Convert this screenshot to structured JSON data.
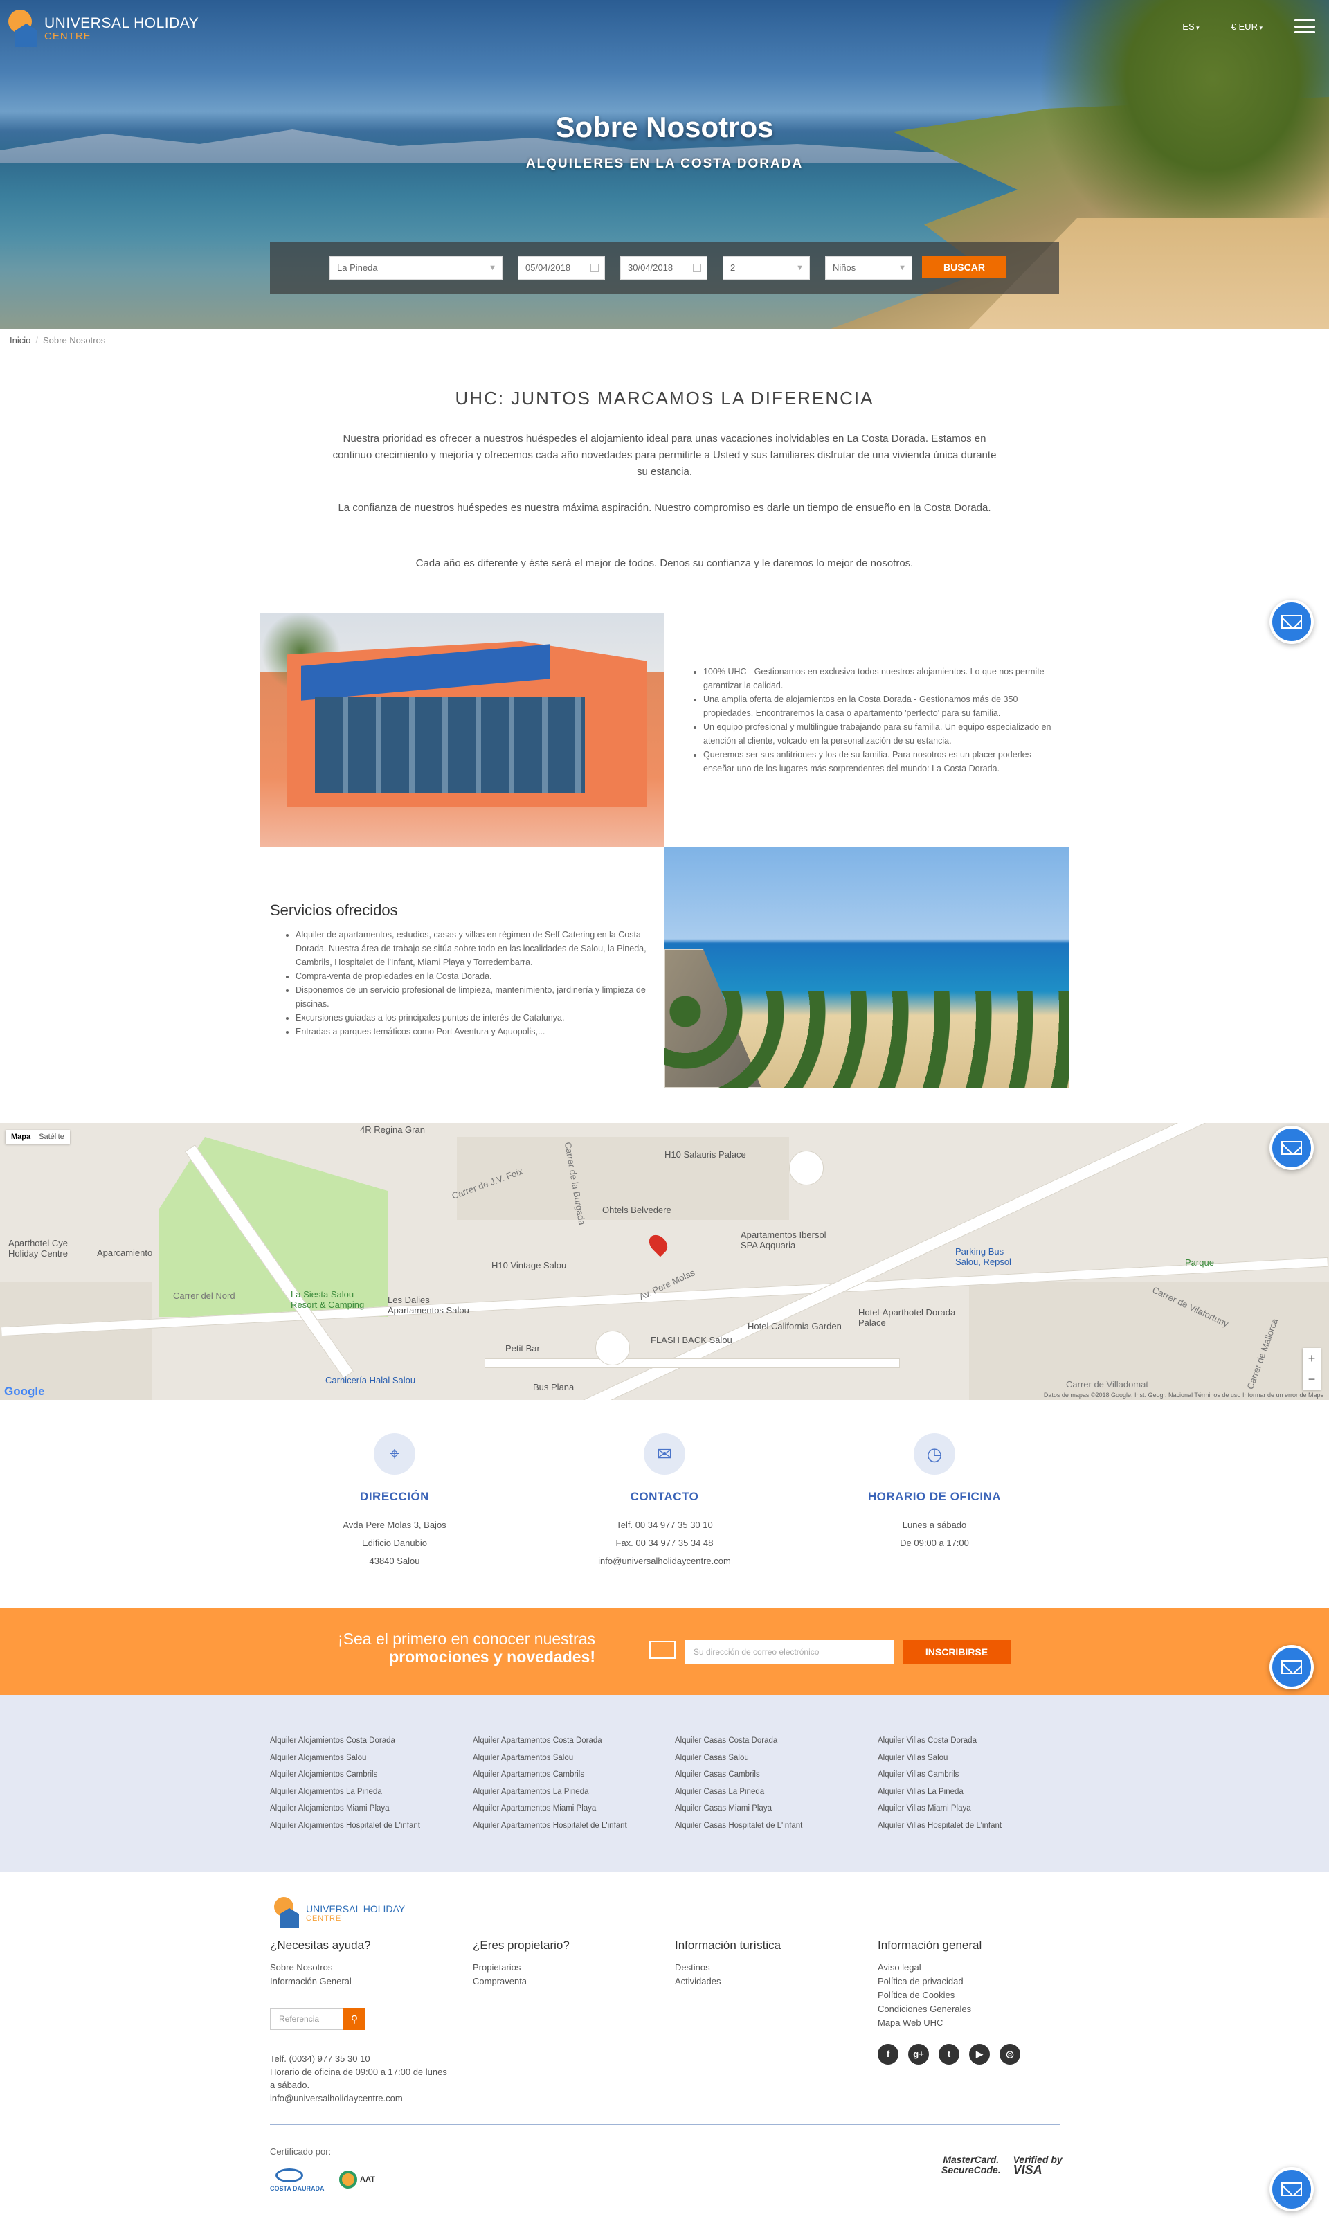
{
  "brand": {
    "name": "UNIVERSAL HOLIDAY",
    "sub": "CENTRE"
  },
  "nav": {
    "lang": "ES",
    "currency": "€ EUR"
  },
  "hero": {
    "title": "Sobre Nosotros",
    "subtitle": "ALQUILERES EN LA COSTA DORADA"
  },
  "search": {
    "location": "La Pineda",
    "checkin": "05/04/2018",
    "checkout": "30/04/2018",
    "adults": "2",
    "children": "Niños",
    "button": "BUSCAR"
  },
  "breadcrumb": {
    "home": "Inicio",
    "current": "Sobre Nosotros"
  },
  "intro": {
    "title": "UHC: JUNTOS MARCAMOS LA DIFERENCIA",
    "p1": "Nuestra prioridad es ofrecer a nuestros huéspedes el alojamiento ideal para unas vacaciones inolvidables en La Costa Dorada. Estamos en continuo crecimiento y mejoría y ofrecemos cada año novedades para permitirle a Usted y sus familiares disfrutar de una vivienda única durante su estancia.",
    "p2": "La confianza de nuestros huéspedes es nuestra máxima aspiración. Nuestro compromiso es darle un tiempo de ensueño en la Costa Dorada.",
    "p3": "Cada año es diferente y éste será el mejor de todos. Denos su confianza y le daremos lo mejor de nosotros."
  },
  "features": [
    "100% UHC - Gestionamos en exclusiva todos nuestros alojamientos. Lo que nos permite garantizar la calidad.",
    "Una amplia oferta de alojamientos en la Costa Dorada - Gestionamos más de 350 propiedades. Encontraremos la casa o apartamento 'perfecto' para su familia.",
    "Un equipo profesional y multilingüe trabajando para su familia. Un equipo especializado en atención al cliente, volcado en la personalización de su estancia.",
    "Queremos ser sus anfitriones y los de su familia. Para nosotros es un placer poderles enseñar uno de los lugares más sorprendentes del mundo: La Costa Dorada."
  ],
  "services": {
    "title": "Servicios ofrecidos",
    "items": [
      "Alquiler de apartamentos, estudios, casas y villas en régimen de Self Catering en la Costa Dorada. Nuestra área de trabajo se sitúa sobre todo en las localidades de Salou, la Pineda, Cambrils, Hospitalet de l'Infant, Miami Playa y Torredembarra.",
      "Compra-venta de propiedades en la Costa Dorada.",
      "Disponemos de un servicio profesional de limpieza, mantenimiento, jardinería y limpieza de piscinas.",
      "Excursiones guiadas a los principales puntos de interés de Catalunya.",
      "Entradas a parques temáticos como Port Aventura y Aquopolis,..."
    ]
  },
  "map": {
    "tab_map": "Mapa",
    "tab_sat": "Satélite",
    "labels": [
      "4R Regina Gran",
      "H10 Salauris Palace",
      "Ohtels Belvedere",
      "H10 Vintage Salou",
      "Apartamentos Ibersol SPA Aqquaria",
      "Aparthotel Cye Holiday Centre",
      "Aparcamiento",
      "Carrer del Nord",
      "La Siesta Salou Resort & Camping",
      "Les Dalies Apartamentos Salou",
      "Hotel California Garden",
      "FLASH BACK Salou",
      "Hotel-Aparthotel Dorada Palace",
      "Parking Bus Salou, Repsol",
      "Parque",
      "Petit Bar",
      "Carnicería Halal Salou",
      "Bus Plana",
      "Av. Pere Molas",
      "Carrer de J.V. Foix",
      "Carrer de la Burgada",
      "Carrer de Vilafortuny",
      "Carrer de Mallorca",
      "Carrer de Villadomat"
    ],
    "attribution": "Datos de mapas ©2018 Google, Inst. Geogr. Nacional   Términos de uso   Informar de un error de Maps",
    "google": "Google"
  },
  "contact": [
    {
      "icon": "location-icon",
      "title": "DIRECCIÓN",
      "lines": [
        "Avda Pere Molas 3, Bajos",
        "Edificio Danubio",
        "43840 Salou"
      ]
    },
    {
      "icon": "mail-icon",
      "title": "CONTACTO",
      "lines": [
        "Telf. 00 34 977 35 30 10",
        "Fax. 00 34 977 35 34 48",
        "info@universalholidaycentre.com"
      ]
    },
    {
      "icon": "clock-icon",
      "title": "HORARIO DE OFICINA",
      "lines": [
        "Lunes a sábado",
        "De 09:00 a 17:00"
      ]
    }
  ],
  "newsletter": {
    "line1": "¡Sea el primero en conocer nuestras",
    "line2": "promociones y novedades!",
    "placeholder": "Su dirección de correo electrónico",
    "button": "INSCRIBIRSE"
  },
  "links": [
    [
      "Alquiler Alojamientos Costa Dorada",
      "Alquiler Alojamientos Salou",
      "Alquiler Alojamientos Cambrils",
      "Alquiler Alojamientos La Pineda",
      "Alquiler Alojamientos Miami Playa",
      "Alquiler Alojamientos Hospitalet de L'infant"
    ],
    [
      "Alquiler Apartamentos Costa Dorada",
      "Alquiler Apartamentos Salou",
      "Alquiler Apartamentos Cambrils",
      "Alquiler Apartamentos La Pineda",
      "Alquiler Apartamentos Miami Playa",
      "Alquiler Apartamentos Hospitalet de L'infant"
    ],
    [
      "Alquiler Casas Costa Dorada",
      "Alquiler Casas Salou",
      "Alquiler Casas Cambrils",
      "Alquiler Casas La Pineda",
      "Alquiler Casas Miami Playa",
      "Alquiler Casas Hospitalet de L'infant"
    ],
    [
      "Alquiler Villas Costa Dorada",
      "Alquiler Villas Salou",
      "Alquiler Villas Cambrils",
      "Alquiler Villas La Pineda",
      "Alquiler Villas Miami Playa",
      "Alquiler Villas Hospitalet de L'infant"
    ]
  ],
  "footer": {
    "col1": {
      "title": "¿Necesitas ayuda?",
      "items": [
        "Sobre Nosotros",
        "Información General"
      ]
    },
    "col2": {
      "title": "¿Eres propietario?",
      "items": [
        "Propietarios",
        "Compraventa"
      ]
    },
    "col3": {
      "title": "Información turística",
      "items": [
        "Destinos",
        "Actividades"
      ]
    },
    "col4": {
      "title": "Información general",
      "items": [
        "Aviso legal",
        "Política de privacidad",
        "Política de Cookies",
        "Condiciones Generales",
        "Mapa Web UHC"
      ]
    },
    "ref_placeholder": "Referencia",
    "contact": [
      "Telf. (0034) 977 35 30 10",
      "Horario de oficina de 09:00 a 17:00 de lunes a sábado.",
      "info@universalholidaycentre.com"
    ],
    "social": [
      "facebook-icon",
      "google-plus-icon",
      "twitter-icon",
      "youtube-icon",
      "instagram-icon"
    ],
    "certified": "Certificado por:",
    "cert1": "COSTA DAURADA",
    "cert2": "AAT",
    "pay1a": "MasterCard.",
    "pay1b": "SecureCode.",
    "pay2a": "Verified by",
    "pay2b": "VISA"
  }
}
